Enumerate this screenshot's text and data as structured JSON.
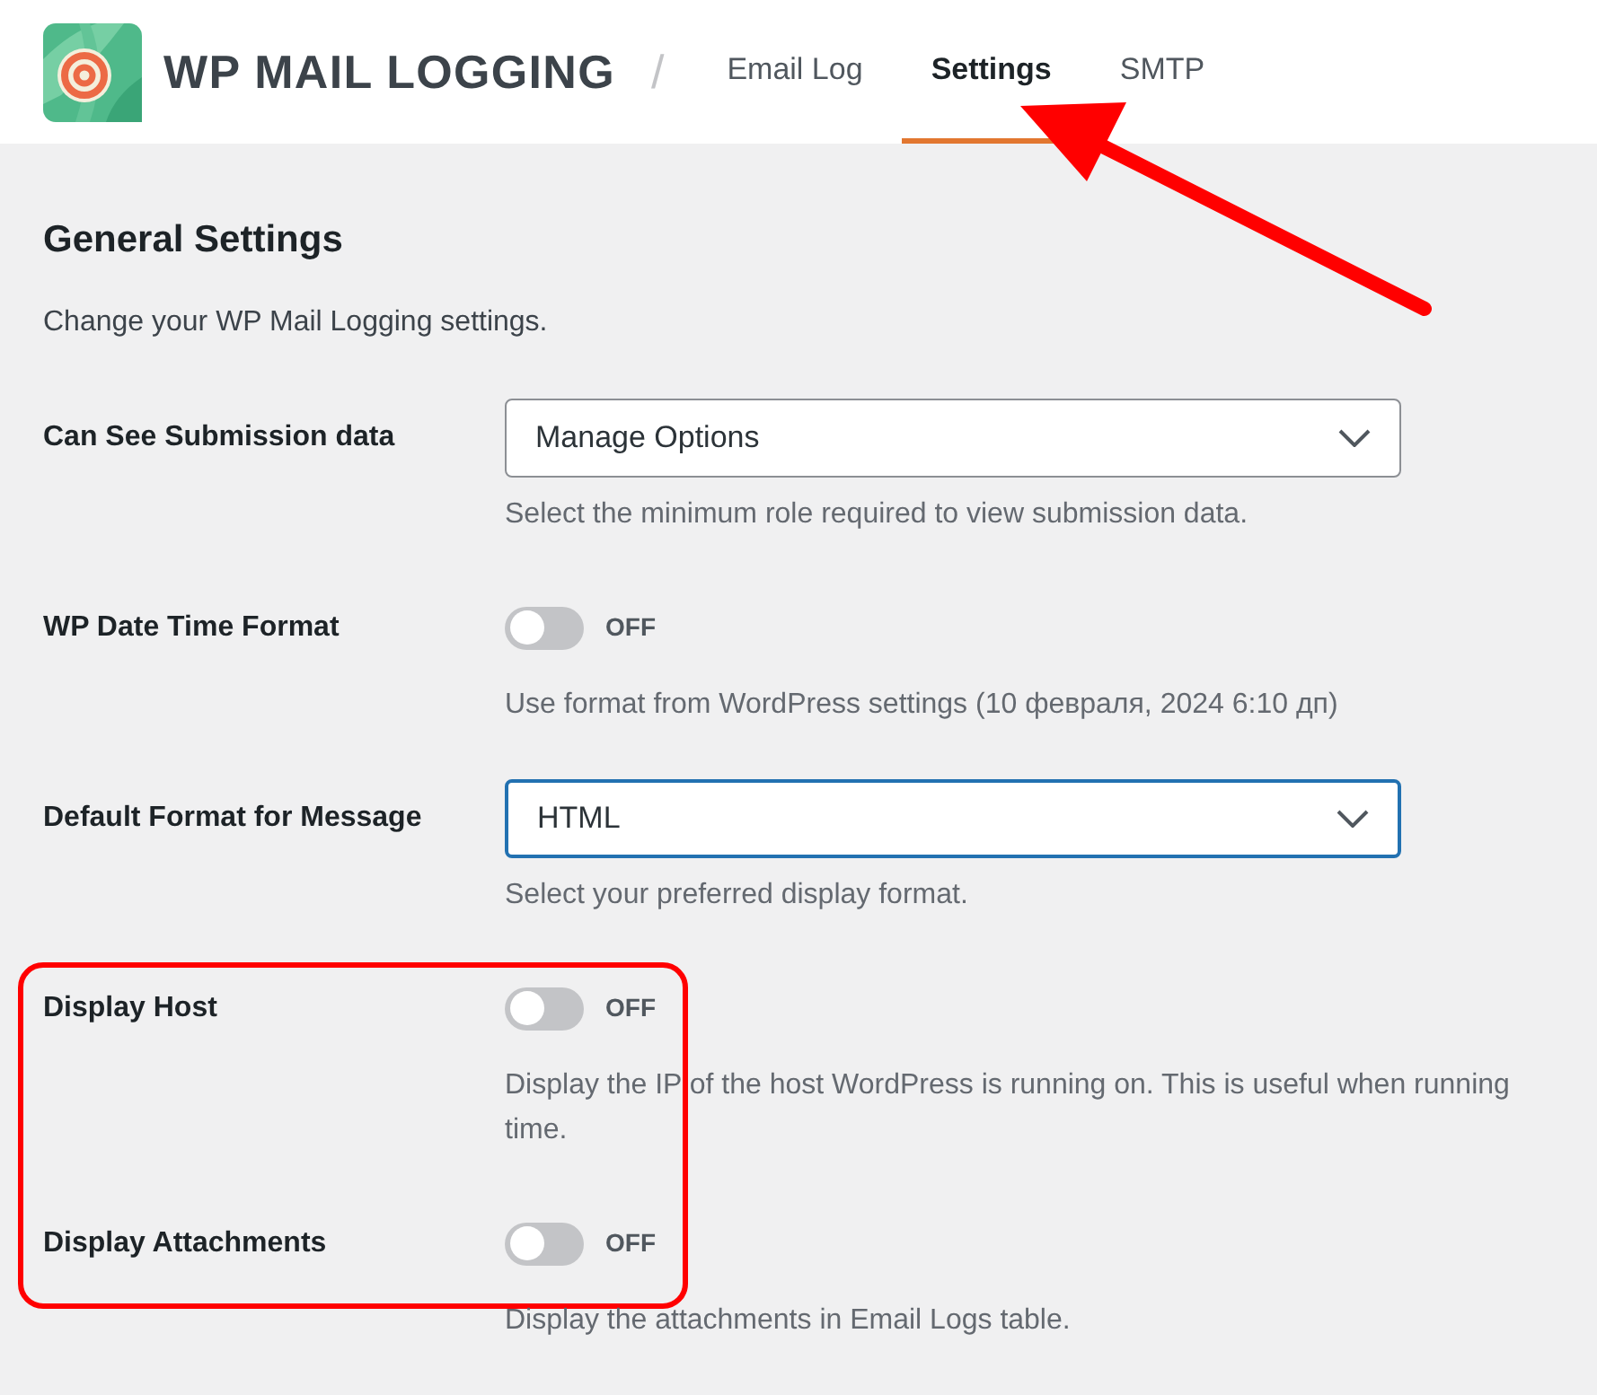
{
  "header": {
    "brand": "WP MAIL LOGGING",
    "separator": "/",
    "tabs": [
      {
        "label": "Email Log",
        "selected": false
      },
      {
        "label": "Settings",
        "selected": true
      },
      {
        "label": "SMTP",
        "selected": false
      }
    ]
  },
  "section": {
    "title": "General Settings",
    "subtitle": "Change your WP Mail Logging settings."
  },
  "settings": [
    {
      "kind": "select",
      "label": "Can See Submission data",
      "value": "Manage Options",
      "focused": false,
      "help": [
        "Select the minimum role required to view submission data."
      ]
    },
    {
      "kind": "toggle",
      "label": "WP Date Time Format",
      "on": false,
      "state_text": "OFF",
      "help": [
        "Use format from WordPress settings (10 февраля, 2024 6:10 дп)"
      ]
    },
    {
      "kind": "select",
      "label": "Default Format for Message",
      "value": "HTML",
      "focused": true,
      "help": [
        "Select your preferred display format."
      ]
    },
    {
      "kind": "toggle",
      "label": "Display Host",
      "on": false,
      "state_text": "OFF",
      "help": [
        "Display the IP of the host WordPress is running on. This is useful when running",
        "time."
      ]
    },
    {
      "kind": "toggle",
      "label": "Display Attachments",
      "on": false,
      "state_text": "OFF",
      "help": [
        "Display the attachments in Email Logs table."
      ]
    }
  ]
}
